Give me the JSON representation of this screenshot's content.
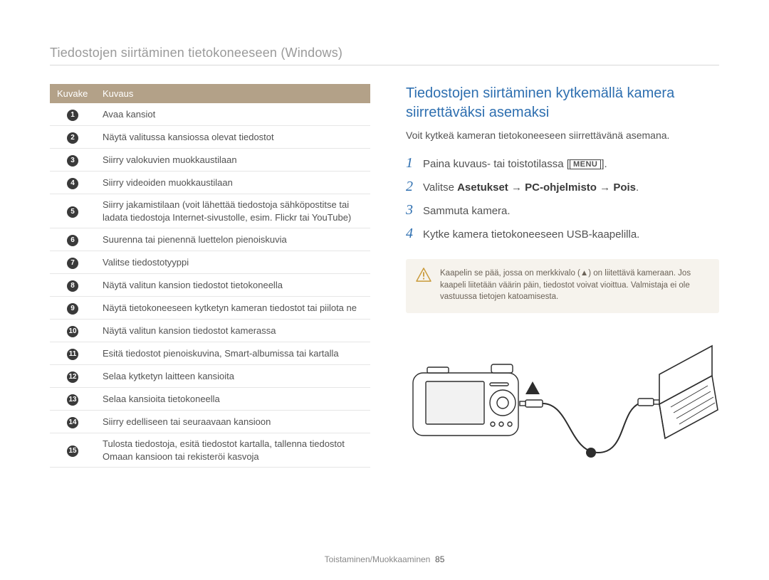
{
  "page_title": "Tiedostojen siirtäminen tietokoneeseen (Windows)",
  "table": {
    "head_icon": "Kuvake",
    "head_desc": "Kuvaus",
    "rows": [
      "Avaa kansiot",
      "Näytä valitussa kansiossa olevat tiedostot",
      "Siirry valokuvien muokkaustilaan",
      "Siirry videoiden muokkaustilaan",
      "Siirry jakamistilaan (voit lähettää tiedostoja sähköpostitse tai ladata tiedostoja Internet-sivustolle, esim. Flickr tai YouTube)",
      "Suurenna tai pienennä luettelon pienoiskuvia",
      "Valitse tiedostotyyppi",
      "Näytä valitun kansion tiedostot tietokoneella",
      "Näytä tietokoneeseen kytketyn kameran tiedostot tai piilota ne",
      "Näytä valitun kansion tiedostot kamerassa",
      "Esitä tiedostot pienoiskuvina, Smart-albumissa tai kartalla",
      "Selaa kytketyn laitteen kansioita",
      "Selaa kansioita tietokoneella",
      "Siirry edelliseen tai seuraavaan kansioon",
      "Tulosta tiedostoja, esitä tiedostot kartalla, tallenna tiedostot Omaan kansioon tai rekisteröi kasvoja"
    ]
  },
  "section": {
    "heading": "Tiedostojen siirtäminen kytkemällä kamera siirrettäväksi asemaksi",
    "intro": "Voit kytkeä kameran tietokoneeseen siirrettävänä asemana."
  },
  "steps": {
    "s1_a": "Paina kuvaus- tai toistotilassa [",
    "s1_menu": "MENU",
    "s1_b": "].",
    "s2_a": "Valitse ",
    "s2_b": "Asetukset",
    "s2_c": "PC-ohjelmisto",
    "s2_d": "Pois",
    "s3": "Sammuta kamera.",
    "s4": "Kytke kamera tietokoneeseen USB-kaapelilla."
  },
  "warning": "Kaapelin se pää, jossa on merkkivalo (▲) on liitettävä kameraan. Jos kaapeli liitetään väärin päin, tiedostot voivat vioittua. Valmistaja ei ole vastuussa tietojen katoamisesta.",
  "footer": {
    "section": "Toistaminen/Muokkaaminen",
    "page": "85"
  }
}
